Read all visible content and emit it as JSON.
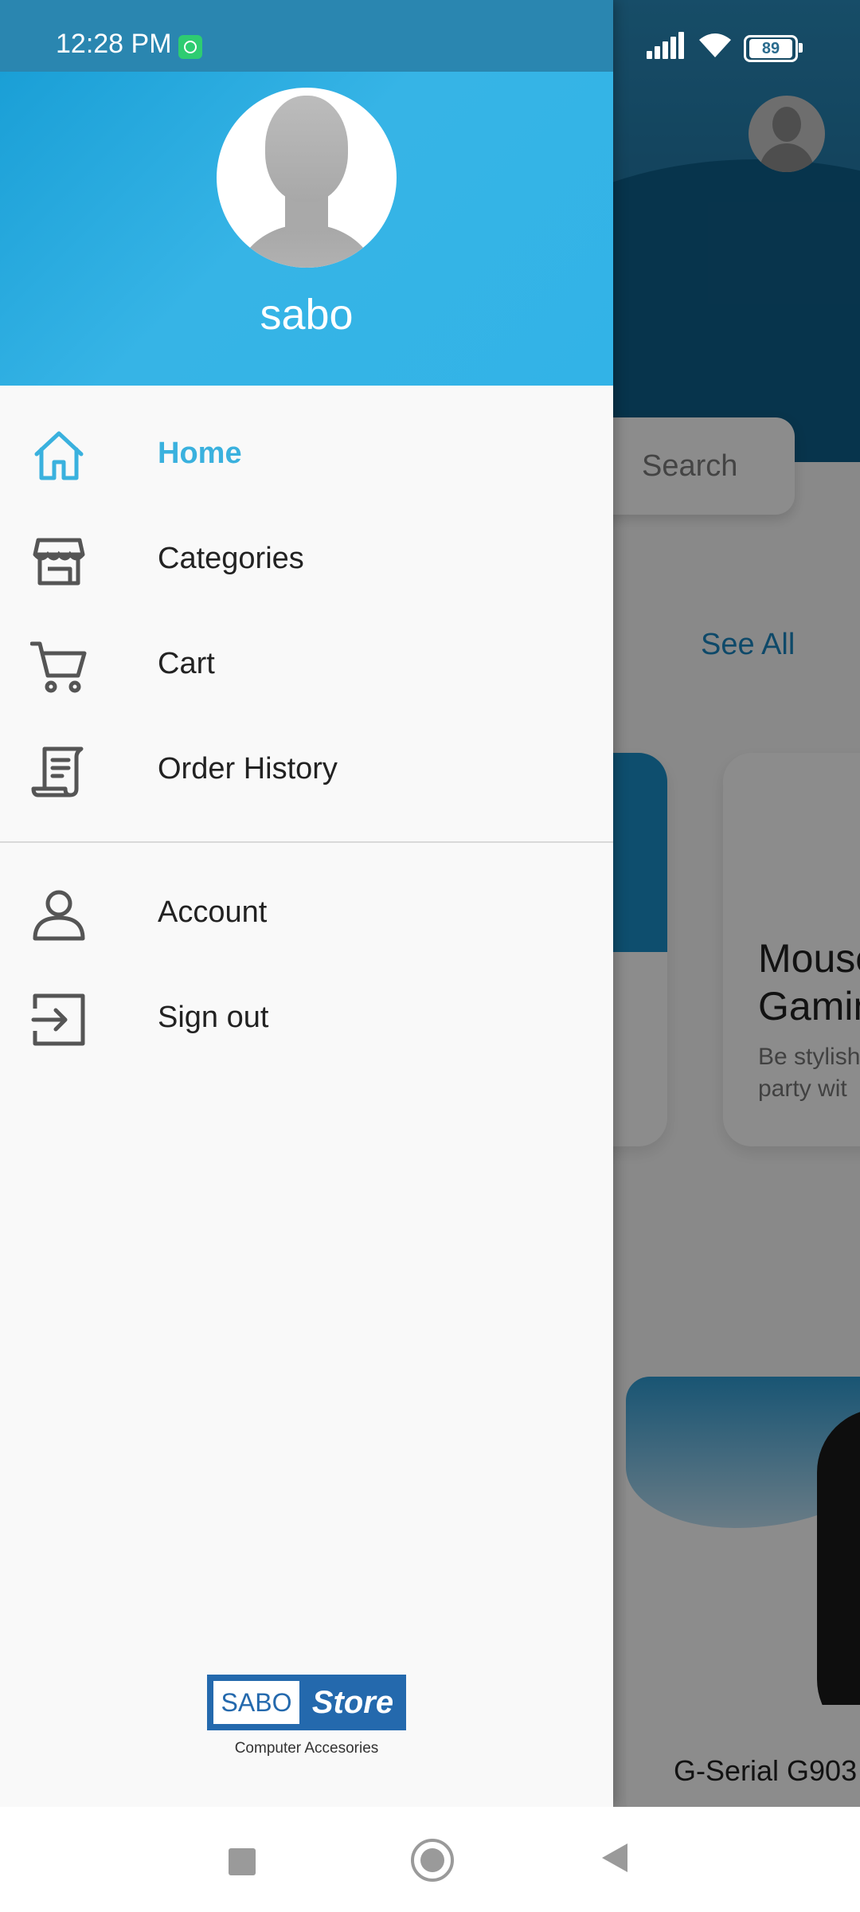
{
  "status_bar": {
    "time": "12:28 PM",
    "battery": "89",
    "icons": [
      "whatsapp-notification-icon",
      "signal-icon",
      "wifi-icon",
      "battery-icon"
    ]
  },
  "drawer": {
    "username": "sabo",
    "menu": [
      {
        "label": "Home",
        "icon": "home-icon",
        "active": true
      },
      {
        "label": "Categories",
        "icon": "store-icon",
        "active": false
      },
      {
        "label": "Cart",
        "icon": "cart-icon",
        "active": false
      },
      {
        "label": "Order History",
        "icon": "receipt-scroll-icon",
        "active": false
      }
    ],
    "account_menu": [
      {
        "label": "Account",
        "icon": "user-icon"
      },
      {
        "label": "Sign out",
        "icon": "sign-out-icon"
      }
    ],
    "logo": {
      "left": "SABO",
      "right": "Store",
      "subtitle": "Computer Accesories"
    },
    "colors": {
      "header": "#32b3e7",
      "active": "#3ab1de"
    }
  },
  "background": {
    "search_placeholder": "Search",
    "see_all": "See All",
    "card_title": "Mouse Gaming",
    "card_desc": "Be stylish party wit",
    "product_title": "G-Serial G903"
  },
  "nav_bar": {
    "buttons": [
      "recents-button",
      "home-button",
      "back-button"
    ]
  }
}
